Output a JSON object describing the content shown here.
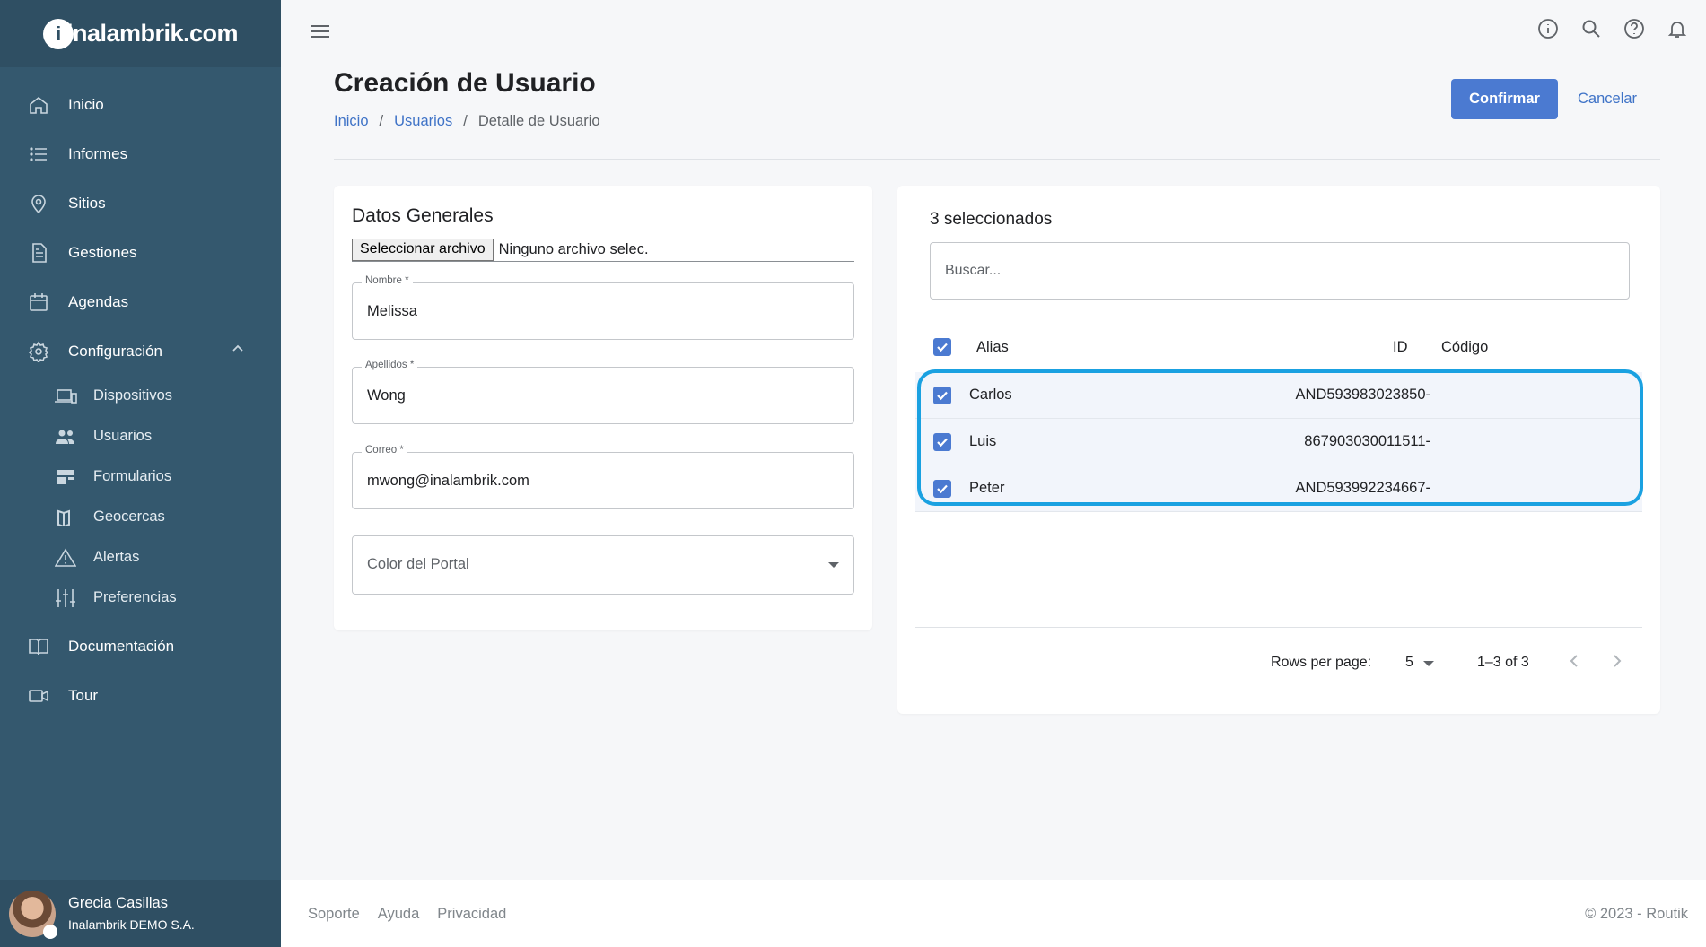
{
  "brand": {
    "logo_text": "inalambrik.com"
  },
  "sidebar": {
    "items": [
      {
        "label": "Inicio",
        "icon": "home-icon"
      },
      {
        "label": "Informes",
        "icon": "list-icon"
      },
      {
        "label": "Sitios",
        "icon": "location-pin-icon"
      },
      {
        "label": "Gestiones",
        "icon": "document-icon"
      },
      {
        "label": "Agendas",
        "icon": "calendar-icon"
      },
      {
        "label": "Configuración",
        "icon": "gear-icon",
        "expanded": true
      }
    ],
    "sub_items": [
      {
        "label": "Dispositivos",
        "icon": "devices-icon"
      },
      {
        "label": "Usuarios",
        "icon": "users-icon"
      },
      {
        "label": "Formularios",
        "icon": "forms-icon"
      },
      {
        "label": "Geocercas",
        "icon": "map-icon"
      },
      {
        "label": "Alertas",
        "icon": "warning-icon"
      },
      {
        "label": "Preferencias",
        "icon": "sliders-icon"
      }
    ],
    "bottom_items": [
      {
        "label": "Documentación",
        "icon": "book-icon"
      },
      {
        "label": "Tour",
        "icon": "video-icon"
      }
    ],
    "user": {
      "name": "Grecia Casillas",
      "org": "Inalambrik DEMO S.A."
    }
  },
  "topbar": {
    "icons": [
      "info-icon",
      "search-icon",
      "help-icon",
      "bell-icon"
    ]
  },
  "header": {
    "title": "Creación de Usuario",
    "breadcrumb": [
      "Inicio",
      "Usuarios",
      "Detalle de Usuario"
    ],
    "confirm_label": "Confirmar",
    "cancel_label": "Cancelar"
  },
  "form": {
    "section_title": "Datos Generales",
    "file_button": "Seleccionar archivo",
    "file_status": "Ninguno archivo selec.",
    "nombre": {
      "label": "Nombre *",
      "value": "Melissa"
    },
    "apellidos": {
      "label": "Apellidos *",
      "value": "Wong"
    },
    "correo": {
      "label": "Correo *",
      "value": "mwong@inalambrik.com"
    },
    "color_placeholder": "Color del Portal"
  },
  "devices": {
    "selected_text": "3 seleccionados",
    "search_placeholder": "Buscar...",
    "columns": {
      "alias": "Alias",
      "id": "ID",
      "codigo": "Código"
    },
    "rows": [
      {
        "alias": "Carlos",
        "id": "AND593983023850-",
        "checked": true
      },
      {
        "alias": "Luis",
        "id": "867903030011511-",
        "checked": true
      },
      {
        "alias": "Peter",
        "id": "AND593992234667-",
        "checked": true
      }
    ],
    "pagination": {
      "rows_per_page_label": "Rows per page:",
      "rows_per_page": "5",
      "range": "1–3 of 3"
    }
  },
  "footer": {
    "links": [
      "Soporte",
      "Ayuda",
      "Privacidad"
    ],
    "copyright": "© 2023 - Routik"
  },
  "colors": {
    "sidebar": "#34586e",
    "accent": "#4b7ad1",
    "highlight": "#1aa1e1"
  }
}
